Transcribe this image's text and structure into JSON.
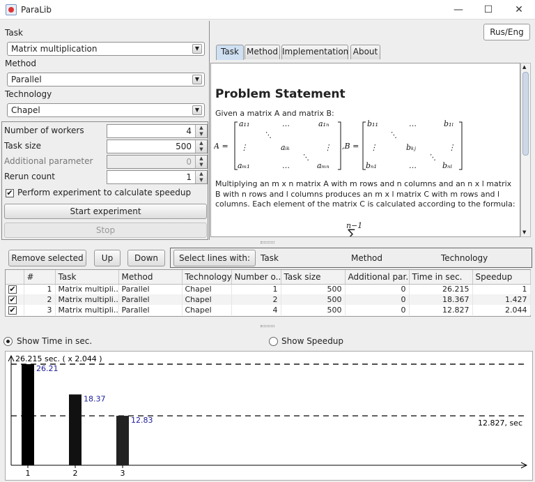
{
  "window": {
    "title": "ParaLib",
    "min": "—",
    "max": "☐",
    "close": "✕"
  },
  "left": {
    "task_label": "Task",
    "task_value": "Matrix multiplication",
    "method_label": "Method",
    "method_value": "Parallel",
    "tech_label": "Technology",
    "tech_value": "Chapel",
    "workers_label": "Number of workers",
    "workers_value": "4",
    "tasksize_label": "Task size",
    "tasksize_value": "500",
    "addparam_label": "Additional parameter",
    "addparam_value": "0",
    "rerun_label": "Rerun count",
    "rerun_value": "1",
    "speedup_check_label": "Perform experiment to calculate speedup",
    "start_label": "Start experiment",
    "stop_label": "Stop"
  },
  "right": {
    "lang_button": "Rus/Eng",
    "tabs": [
      "Task",
      "Method",
      "Implementation",
      "About"
    ],
    "doc": {
      "heading": "Problem Statement",
      "intro": "Given a matrix A and matrix B:",
      "para1": "Multiplying an m x n matrix A with m rows and n columns and an n x l matrix B with n rows and l columns produces an m x l matrix C with m rows and l columns. Each element of the matrix C is calculated according to the formula:",
      "sum_top": "n−1"
    }
  },
  "toolbar": {
    "remove": "Remove selected",
    "up": "Up",
    "down": "Down",
    "select_lines": "Select lines with:",
    "opt_task": "Task",
    "opt_method": "Method",
    "opt_technology": "Technology"
  },
  "table": {
    "headers": [
      "#",
      "Task",
      "Method",
      "Technology",
      "Number o...",
      "Task size",
      "Additional par...",
      "Time in sec.",
      "Speedup"
    ],
    "rows": [
      [
        "1",
        "Matrix multipli...",
        "Parallel",
        "Chapel",
        "1",
        "500",
        "0",
        "26.215",
        "1"
      ],
      [
        "2",
        "Matrix multipli...",
        "Parallel",
        "Chapel",
        "2",
        "500",
        "0",
        "18.367",
        "1.427"
      ],
      [
        "3",
        "Matrix multipli...",
        "Parallel",
        "Chapel",
        "4",
        "500",
        "0",
        "12.827",
        "2.044"
      ]
    ]
  },
  "view": {
    "time_label": "Show Time in sec.",
    "speedup_label": "Show Speedup"
  },
  "chart_data": {
    "type": "bar",
    "categories": [
      "1",
      "2",
      "3"
    ],
    "values": [
      26.215,
      18.367,
      12.827
    ],
    "value_labels": [
      "26.21",
      "18.37",
      "12.83"
    ],
    "ylim": [
      0,
      28.4
    ],
    "ref_lines": [
      {
        "value": 26.215,
        "label": "26.215 sec. ( x 2.044 )"
      },
      {
        "value": 12.827,
        "label": "12.827, sec"
      }
    ],
    "colors": {
      "bars": [
        "#000000",
        "#111111",
        "#222222"
      ],
      "labels": "#1a1a9a"
    }
  }
}
